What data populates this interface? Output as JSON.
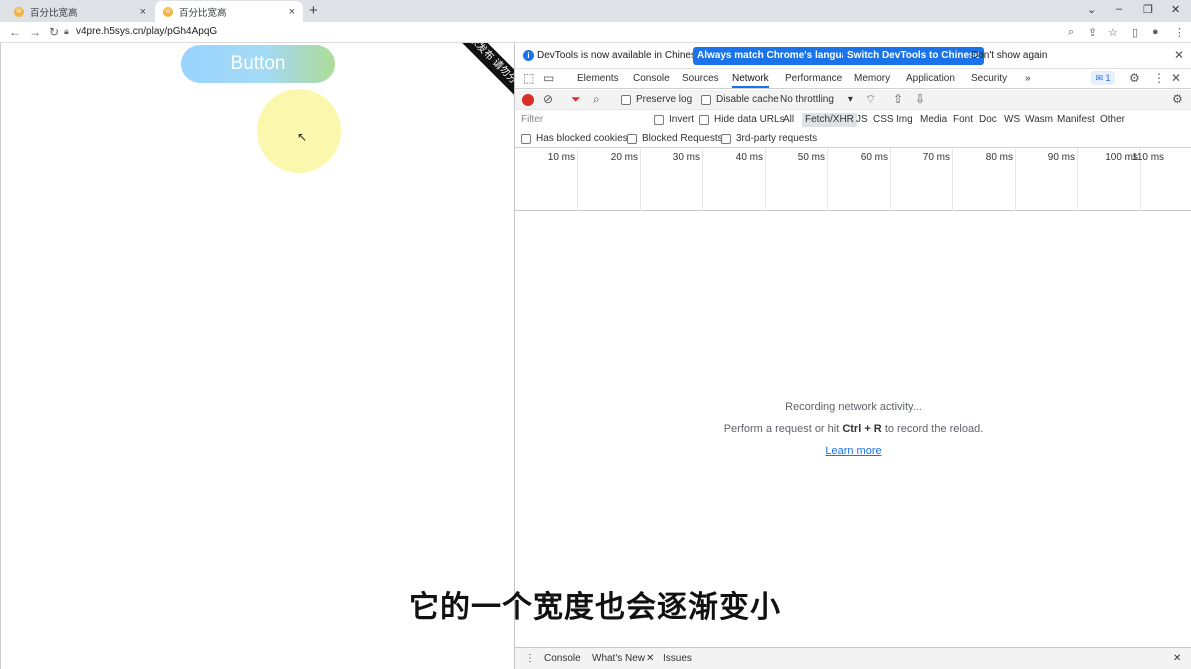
{
  "browser": {
    "tabs": [
      {
        "title": "百分比宽高",
        "close": "×"
      },
      {
        "title": "百分比宽高",
        "close": "×"
      }
    ],
    "new_tab": "+",
    "window_controls": [
      "⌄",
      "–",
      "❐",
      "✕"
    ],
    "url": "v4pre.h5sys.cn/play/pGh4ApqG"
  },
  "page": {
    "button_label": "Button",
    "ribbon_text": "未发布 请勿分享"
  },
  "devtools": {
    "infobar": {
      "message": "DevTools is now available in Chinese!",
      "match_button": "Always match Chrome's language",
      "switch_button": "Switch DevTools to Chinese",
      "dont_show": "Don't show again"
    },
    "tabs": [
      "Elements",
      "Console",
      "Sources",
      "Network",
      "Performance",
      "Memory",
      "Application",
      "Security"
    ],
    "active_tab": "Network",
    "more_tabs": "»",
    "issues_badge": "1",
    "toolbar": {
      "preserve_log": "Preserve log",
      "disable_cache": "Disable cache",
      "throttling": "No throttling"
    },
    "filter": {
      "placeholder": "Filter",
      "invert": "Invert",
      "hide_data_urls": "Hide data URLs",
      "types": [
        "All",
        "Fetch/XHR",
        "JS",
        "CSS",
        "Img",
        "Media",
        "Font",
        "Doc",
        "WS",
        "Wasm",
        "Manifest",
        "Other"
      ],
      "active_type": "Fetch/XHR"
    },
    "block": {
      "blocked_cookies": "Has blocked cookies",
      "blocked_requests": "Blocked Requests",
      "third_party": "3rd-party requests"
    },
    "timeline_ticks": [
      "10 ms",
      "20 ms",
      "30 ms",
      "40 ms",
      "50 ms",
      "60 ms",
      "70 ms",
      "80 ms",
      "90 ms",
      "100 ms",
      "110 ms"
    ],
    "empty": {
      "recording": "Recording network activity...",
      "perform_before": "Perform a request or hit ",
      "shortcut": "Ctrl + R",
      "perform_after": " to record the reload.",
      "learn_more": "Learn more"
    },
    "drawer": {
      "tabs": [
        "Console",
        "What's New",
        "Issues"
      ]
    }
  },
  "subtitle": "它的一个宽度也会逐渐变小"
}
